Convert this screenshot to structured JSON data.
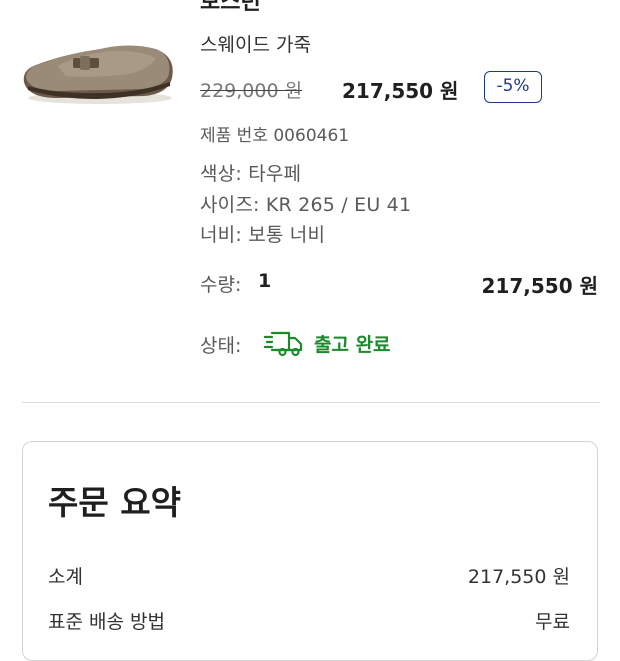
{
  "product": {
    "name": "보스턴",
    "material": "스웨이드 가죽",
    "price_original": "229,000 원",
    "price_sale": "217,550 원",
    "discount": "-5%",
    "sku": "제품 번호 0060461",
    "color": "색상: 타우페",
    "size": "사이즈: KR 265 / EU 41",
    "width": "너비: 보통 너비",
    "quantity_label": "수량:",
    "quantity_value": "1",
    "line_total": "217,550 원",
    "status_label": "상태:",
    "status_text": "출고 완료",
    "status_icon": "delivery-truck-icon",
    "image": "taupe-suede-clog"
  },
  "summary": {
    "title": "주문 요약",
    "rows": [
      {
        "label": "소계",
        "value": "217,550 원"
      },
      {
        "label": "표준 배송 방법",
        "value": "무료"
      }
    ]
  },
  "colors": {
    "status_green": "#1a8a2a",
    "discount_blue": "#1e3a8a"
  }
}
